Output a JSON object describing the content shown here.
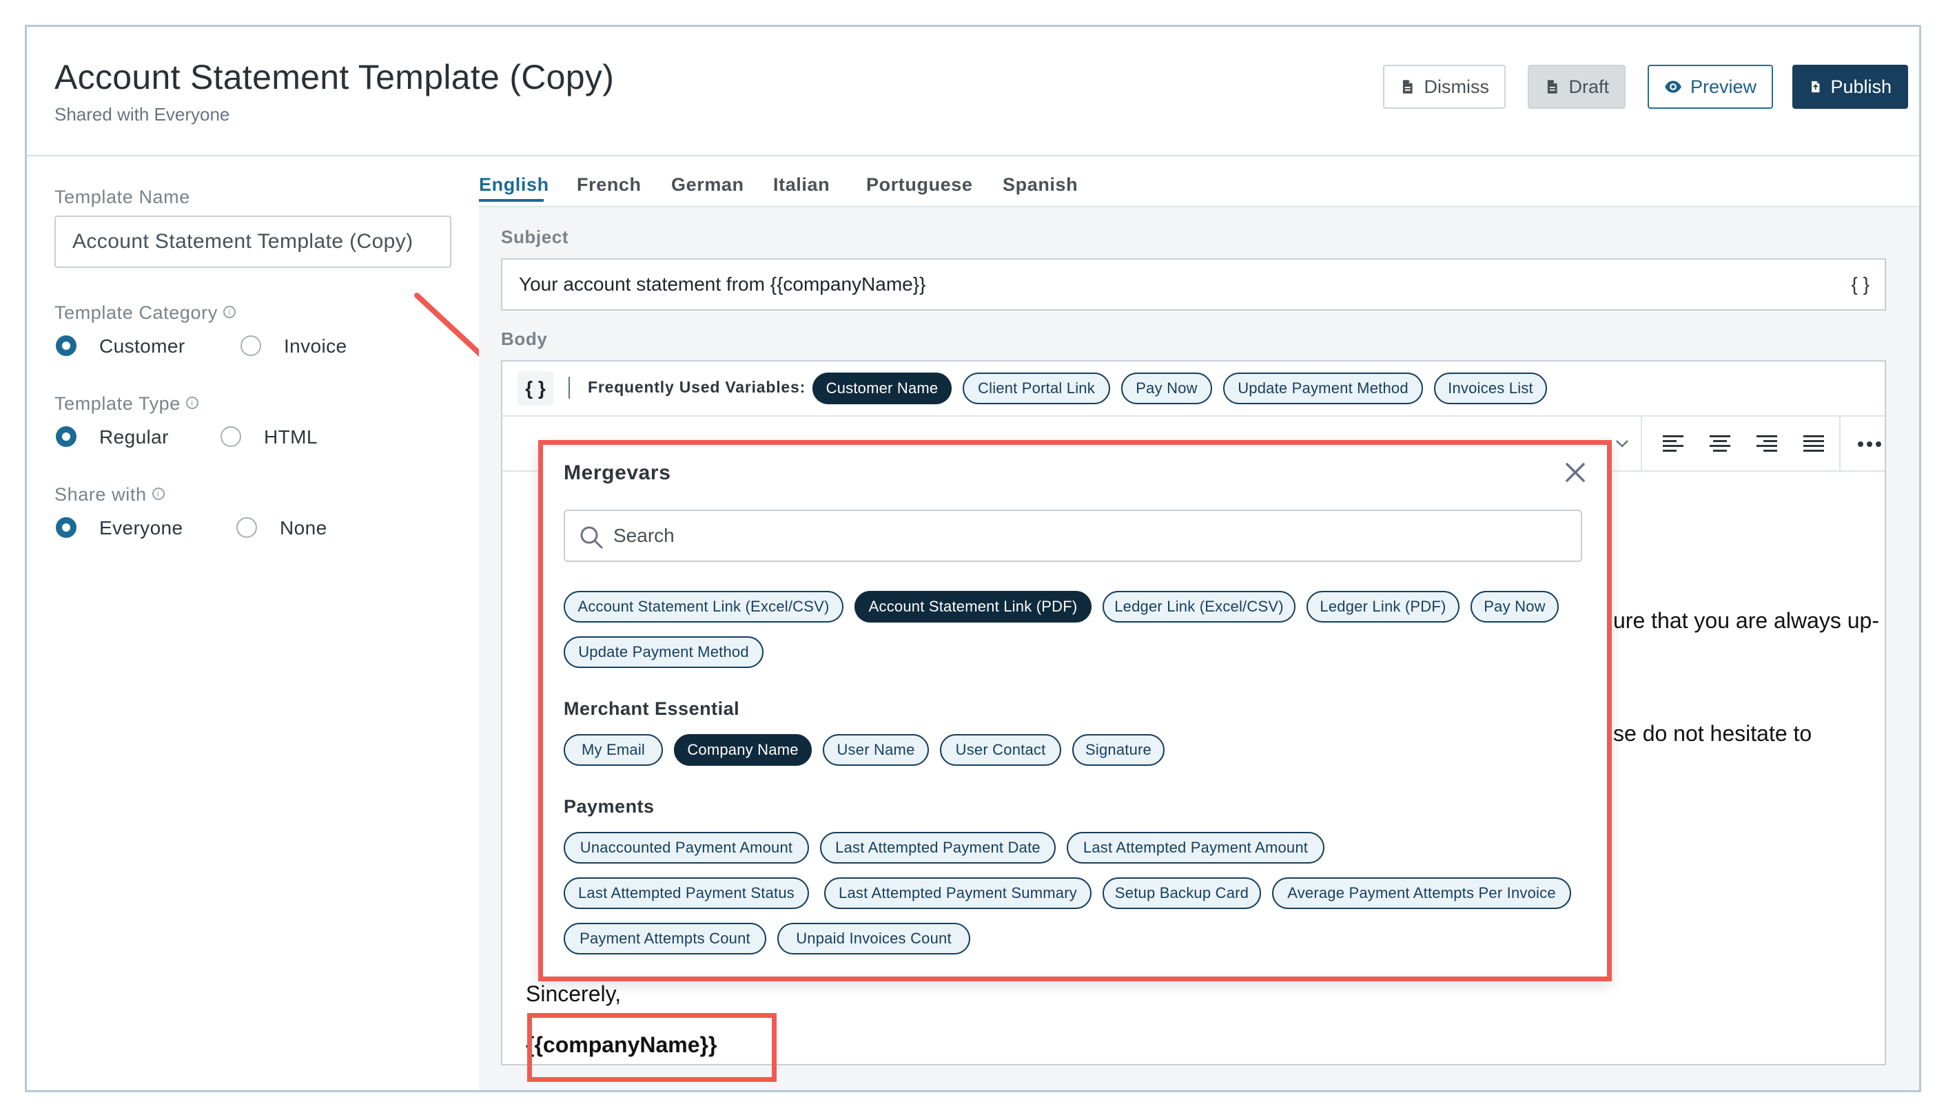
{
  "header": {
    "title": "Account Statement Template (Copy)",
    "subtitle": "Shared with Everyone",
    "buttons": {
      "dismiss": "Dismiss",
      "draft": "Draft",
      "preview": "Preview",
      "publish": "Publish"
    }
  },
  "form": {
    "template_name_label": "Template Name",
    "template_name_value": "Account Statement Template (Copy)",
    "category_label": "Template Category",
    "category_options": [
      "Customer",
      "Invoice"
    ],
    "category_selected": "Customer",
    "type_label": "Template Type",
    "type_options": [
      "Regular",
      "HTML"
    ],
    "type_selected": "Regular",
    "share_label": "Share with",
    "share_options": [
      "Everyone",
      "None"
    ],
    "share_selected": "Everyone"
  },
  "editor": {
    "tabs": [
      "English",
      "French",
      "German",
      "Italian",
      "Portuguese",
      "Spanish"
    ],
    "active_tab": "English",
    "subject_label": "Subject",
    "subject_value": "Your account statement from {{companyName}}",
    "subject_braces": "{ }",
    "body_label": "Body",
    "braces_button": "{ }",
    "frequent_label": "Frequently Used Variables:",
    "frequent_vars": [
      "Customer Name",
      "Client Portal Link",
      "Pay Now",
      "Update Payment Method",
      "Invoices List"
    ],
    "body_fragments": {
      "line1": "ure that you are always up-",
      "line2": "se do not hesitate to",
      "closing": "Sincerely,",
      "signature": "{{companyName}}"
    }
  },
  "mergevars": {
    "title": "Mergevars",
    "search_placeholder": "Search",
    "top_chips": [
      "Account Statement Link (Excel/CSV)",
      "Account Statement Link (PDF)",
      "Ledger Link (Excel/CSV)",
      "Ledger Link (PDF)",
      "Pay Now",
      "Update Payment Method"
    ],
    "merchant_title": "Merchant Essential",
    "merchant_chips": [
      "My Email",
      "Company Name",
      "User Name",
      "User Contact",
      "Signature"
    ],
    "payments_title": "Payments",
    "payments_chips": [
      "Unaccounted Payment Amount",
      "Last Attempted Payment Date",
      "Last Attempted Payment Amount",
      "Last Attempted Payment Status",
      "Last Attempted Payment Summary",
      "Setup Backup Card",
      "Average Payment Attempts Per Invoice",
      "Payment Attempts Count",
      "Unpaid Invoices Count"
    ]
  },
  "colors": {
    "accent": "#1b6a96",
    "dark_chip": "#0f2a3c",
    "highlight": "#ef5b52",
    "publish_bg": "#173e5c"
  }
}
